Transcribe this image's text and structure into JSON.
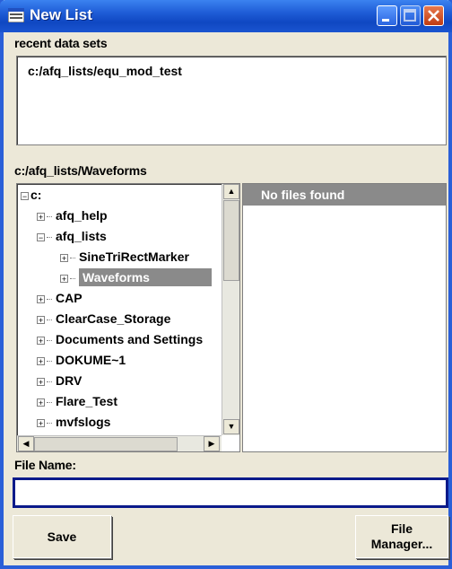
{
  "window": {
    "title": "New List"
  },
  "recent": {
    "label": "recent data sets",
    "items": [
      "c:/afq_lists/equ_mod_test"
    ]
  },
  "browser": {
    "path_label": "c:/afq_lists/Waveforms",
    "tree": [
      {
        "label": "c:",
        "expander": "−",
        "level": 0
      },
      {
        "label": "afq_help",
        "expander": "+",
        "level": 1
      },
      {
        "label": "afq_lists",
        "expander": "−",
        "level": 1
      },
      {
        "label": "SineTriRectMarker",
        "expander": "+",
        "level": 2
      },
      {
        "label": "Waveforms",
        "expander": "+",
        "level": 2,
        "selected": true
      },
      {
        "label": "CAP",
        "expander": "+",
        "level": 1
      },
      {
        "label": "ClearCase_Storage",
        "expander": "+",
        "level": 1
      },
      {
        "label": "Documents and Settings",
        "expander": "+",
        "level": 1
      },
      {
        "label": "DOKUME~1",
        "expander": "+",
        "level": 1
      },
      {
        "label": "DRV",
        "expander": "+",
        "level": 1
      },
      {
        "label": "Flare_Test",
        "expander": "+",
        "level": 1
      },
      {
        "label": "mvfslogs",
        "expander": "+",
        "level": 1
      }
    ],
    "files_header": "No files found"
  },
  "filename": {
    "label": "File Name:",
    "value": ""
  },
  "buttons": {
    "save": "Save",
    "file_manager_line1": "File",
    "file_manager_line2": "Manager..."
  },
  "colors": {
    "titlebar": "#1e5cd6",
    "selection": "#8a8a8a",
    "input_border": "#0a1a8a"
  }
}
